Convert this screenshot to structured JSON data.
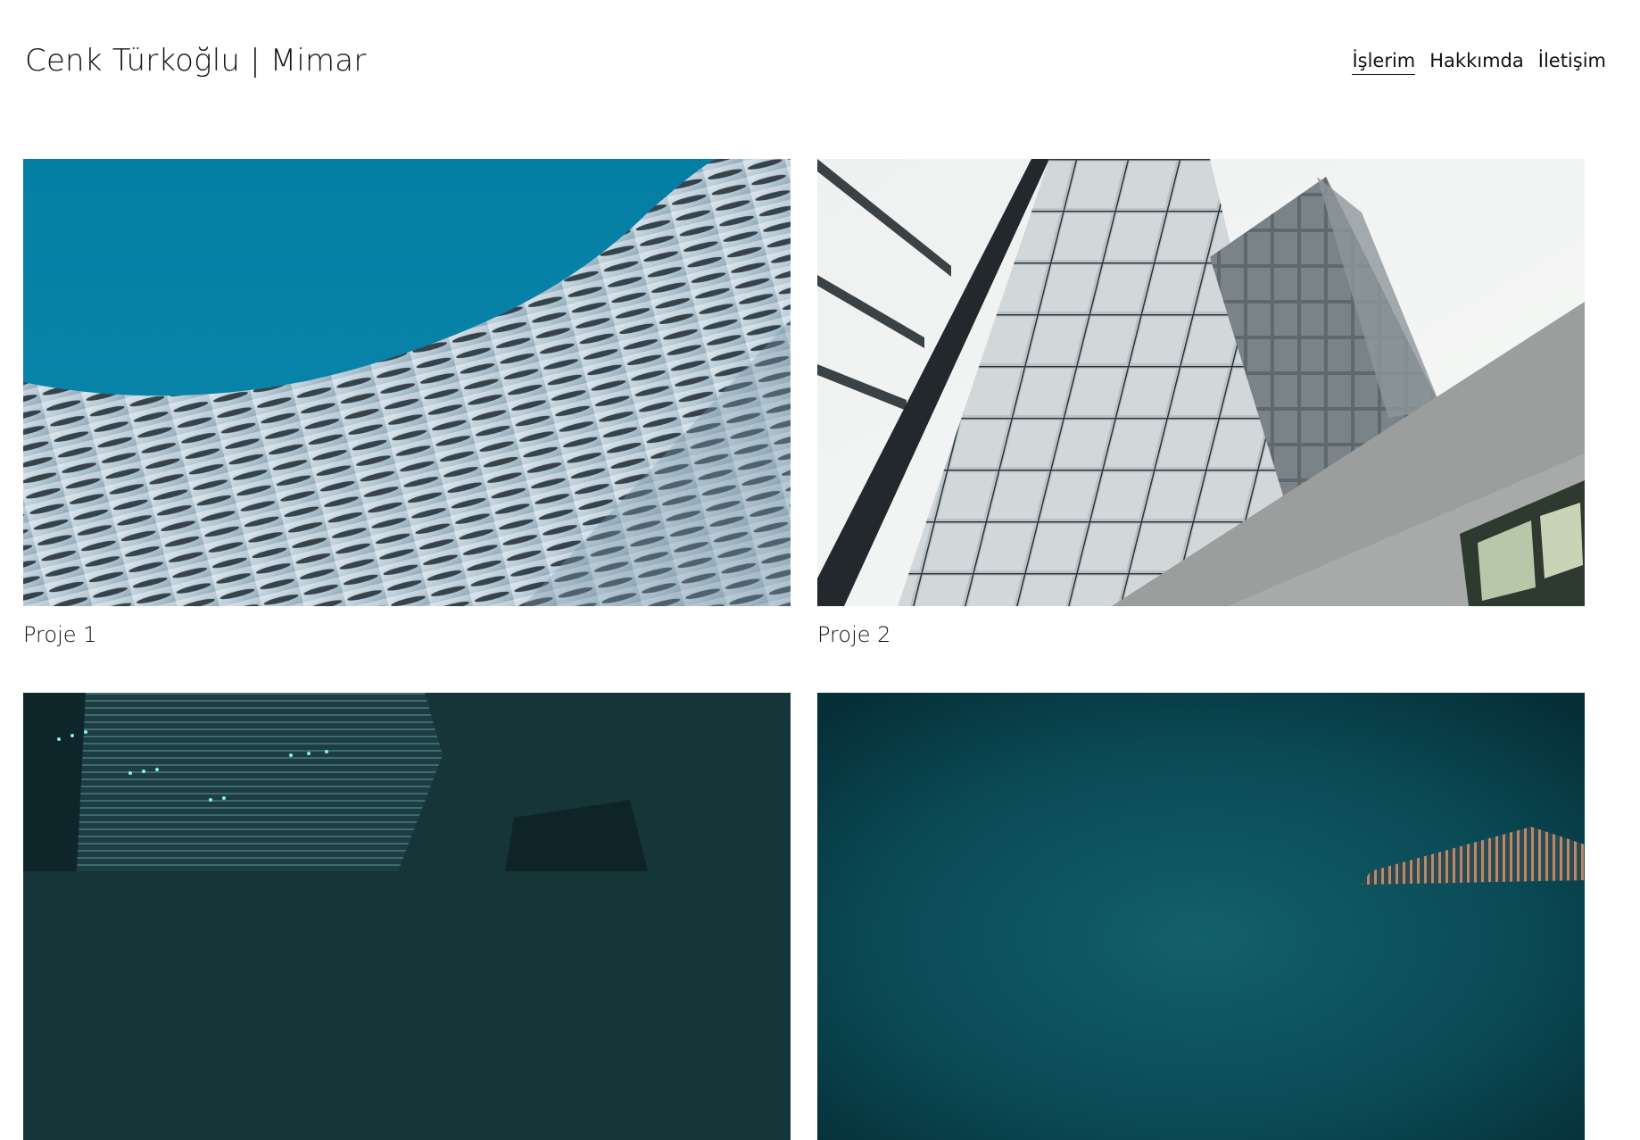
{
  "header": {
    "title": "Cenk Türkoğlu | Mimar"
  },
  "nav": {
    "items": [
      {
        "label": "İşlerim",
        "active": true
      },
      {
        "label": "Hakkımda",
        "active": false
      },
      {
        "label": "İletişim",
        "active": false
      }
    ]
  },
  "projects": [
    {
      "label": "Proje 1"
    },
    {
      "label": "Proje 2"
    },
    {
      "label": "",
      "note": ""
    },
    {
      "label": ""
    }
  ],
  "colors": {
    "text": "#111111",
    "background": "#ffffff",
    "sky_blue": "#0b7fa5",
    "night_teal": "#143a3f",
    "deep_teal": "#0d4a57"
  }
}
